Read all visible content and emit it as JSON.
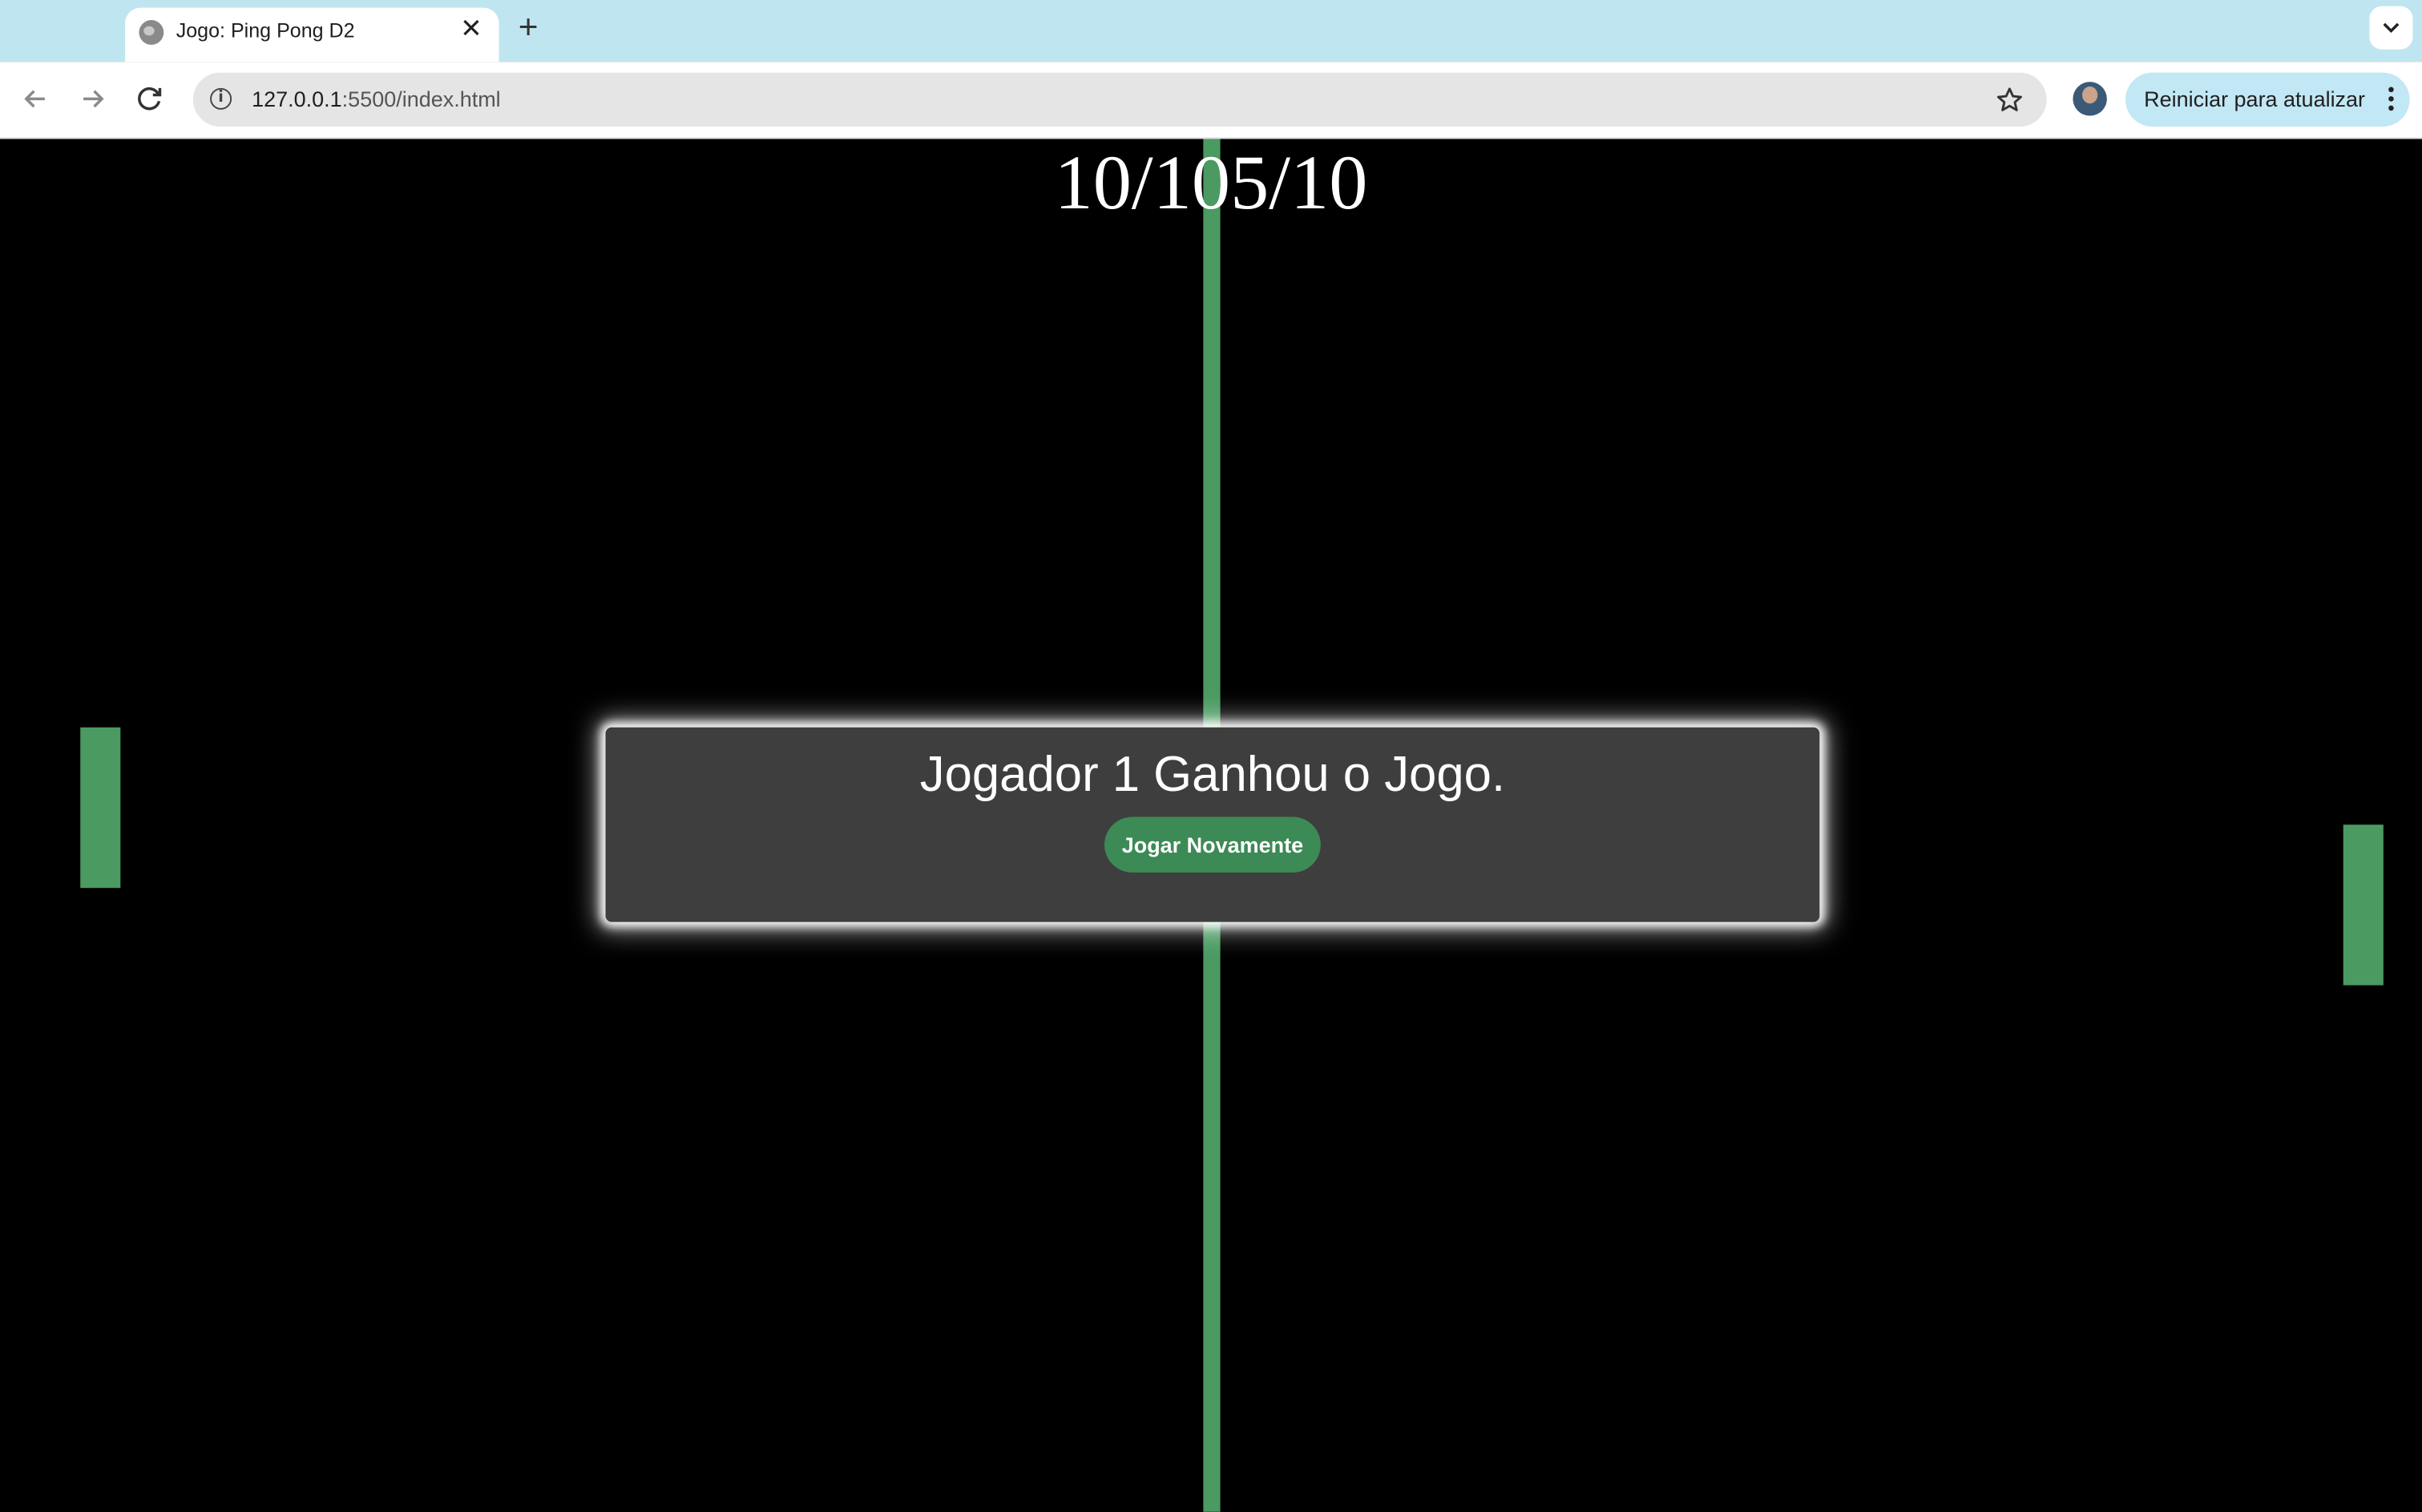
{
  "browser": {
    "tab_title": "Jogo: Ping Pong D2",
    "tab_close": "✕",
    "new_tab": "+",
    "url_host": "127.0.0.1",
    "url_rest": ":5500/index.html",
    "update_button": "Reiniciar para atualizar"
  },
  "game": {
    "score_text": "10/105/10",
    "winner_message": "Jogador 1 Ganhou o Jogo.",
    "play_again_label": "Jogar Novamente",
    "accent_color": "#4a9a62",
    "background_color": "#000000"
  },
  "icons": {
    "back": "arrow-left-icon",
    "forward": "arrow-right-icon",
    "reload": "reload-icon",
    "info": "info-icon",
    "bookmark": "star-icon",
    "menu": "more-vert-icon",
    "tab_list": "chevron-down-icon"
  }
}
